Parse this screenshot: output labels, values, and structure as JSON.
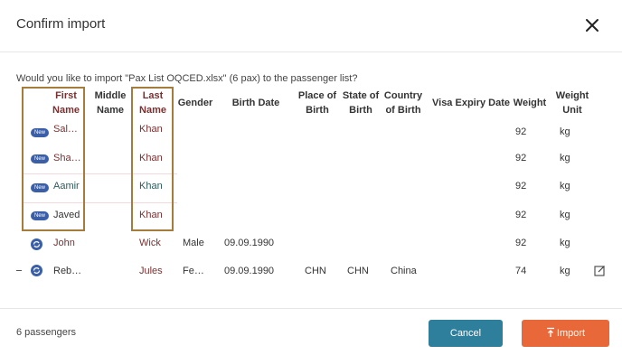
{
  "dialog": {
    "title": "Confirm import",
    "question": "Would you like to import \"Pax List OQCED.xlsx\" (6 pax) to the passenger list?"
  },
  "columns": {
    "first_name": "First Name",
    "middle_name": "Middle Name",
    "last_name": "Last Name",
    "gender": "Gender",
    "birth_date": "Birth Date",
    "place_of_birth": "Place of Birth",
    "state_of_birth": "State of Birth",
    "country_of_birth": "Country of Birth",
    "visa_expiry": "Visa Expiry Date",
    "weight": "Weight",
    "weight_unit": "Weight Unit"
  },
  "new_badge": "New",
  "rows": [
    {
      "status": "new",
      "first": "Sal…",
      "last": "Khan",
      "gender": "",
      "birth": "",
      "place": "",
      "state": "",
      "country": "",
      "weight": "92",
      "unit": "kg"
    },
    {
      "status": "new",
      "first": "Sha…",
      "last": "Khan",
      "gender": "",
      "birth": "",
      "place": "",
      "state": "",
      "country": "",
      "weight": "92",
      "unit": "kg"
    },
    {
      "status": "new",
      "first": "Aamir",
      "last": "Khan",
      "gender": "",
      "birth": "",
      "place": "",
      "state": "",
      "country": "",
      "weight": "92",
      "unit": "kg"
    },
    {
      "status": "new",
      "first": "Javed",
      "last": "Khan",
      "gender": "",
      "birth": "",
      "place": "",
      "state": "",
      "country": "",
      "weight": "92",
      "unit": "kg"
    },
    {
      "status": "sync",
      "first": "John",
      "last": "Wick",
      "gender": "Male",
      "birth": "09.09.1990",
      "place": "",
      "state": "",
      "country": "",
      "weight": "92",
      "unit": "kg"
    },
    {
      "status": "sync",
      "first": "Reb…",
      "last": "Jules",
      "gender": "Fe…",
      "birth": "09.09.1990",
      "place": "CHN",
      "state": "CHN",
      "country": "China",
      "weight": "74",
      "unit": "kg"
    }
  ],
  "footer": {
    "count_text": "6 passengers",
    "cancel_label": "Cancel",
    "import_label": "Import"
  },
  "colors": {
    "cancel": "#2d7f9c",
    "import": "#e8683a",
    "highlight": "#a67c3c",
    "badge": "#3a5fa8"
  },
  "icons": [
    "close-icon",
    "sync-icon",
    "edit-icon",
    "upload-icon"
  ]
}
